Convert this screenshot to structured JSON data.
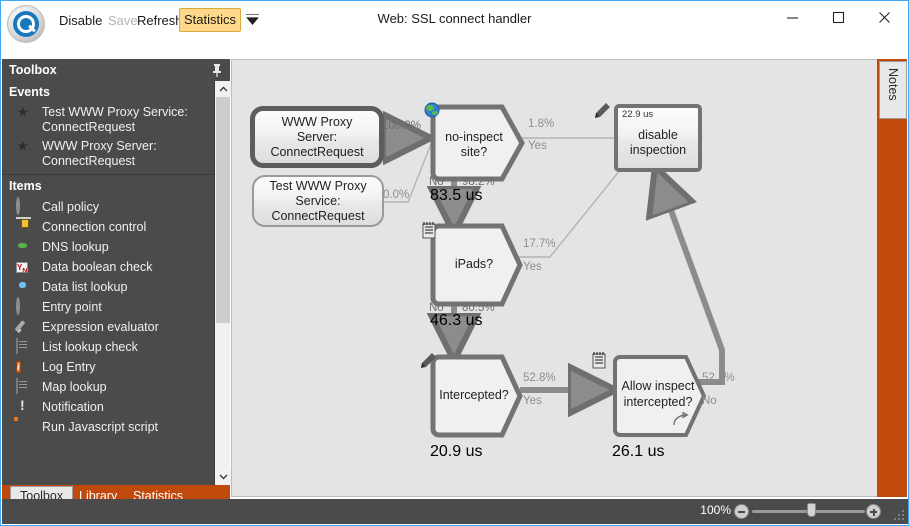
{
  "window": {
    "title": "Web: SSL connect handler",
    "logo_icon": "app-logo-icon",
    "minimize_icon": "minimize-icon",
    "maximize_icon": "maximize-icon",
    "close_icon": "close-icon"
  },
  "toolbar": {
    "disable_label": "Disable",
    "save_label": "Save",
    "refresh_label": "Refresh",
    "statistics_label": "Statistics",
    "overflow_icon": "chevron-down-icon"
  },
  "toolbox": {
    "title": "Toolbox",
    "pin_icon": "pin-icon",
    "groups": [
      {
        "title": "Events",
        "items": [
          {
            "label": "Test WWW Proxy Service: ConnectRequest",
            "icon": "star-icon"
          },
          {
            "label": "WWW Proxy Server: ConnectRequest",
            "icon": "star-icon"
          }
        ]
      },
      {
        "title": "Items",
        "items": [
          {
            "label": "Call policy",
            "icon": "call-policy-icon"
          },
          {
            "label": "Connection control",
            "icon": "connection-control-icon"
          },
          {
            "label": "DNS lookup",
            "icon": "dns-lookup-icon"
          },
          {
            "label": "Data boolean check",
            "icon": "data-boolean-check-icon"
          },
          {
            "label": "Data list lookup",
            "icon": "data-list-lookup-icon"
          },
          {
            "label": "Entry point",
            "icon": "entry-point-icon"
          },
          {
            "label": "Expression evaluator",
            "icon": "expression-evaluator-icon"
          },
          {
            "label": "List lookup check",
            "icon": "list-lookup-check-icon"
          },
          {
            "label": "Log Entry",
            "icon": "log-entry-icon"
          },
          {
            "label": "Map lookup",
            "icon": "map-lookup-icon"
          },
          {
            "label": "Notification",
            "icon": "notification-icon"
          },
          {
            "label": "Run Javascript script",
            "icon": "run-javascript-script-icon"
          }
        ]
      }
    ],
    "scroll_up_icon": "chevron-up-icon",
    "scroll_down_icon": "chevron-down-icon",
    "tabs": [
      {
        "label": "Toolbox",
        "active": true
      },
      {
        "label": "Library",
        "active": false
      },
      {
        "label": "Statistics",
        "active": false
      }
    ]
  },
  "notes_panel": {
    "label": "Notes"
  },
  "statusbar": {
    "zoom_label": "100%",
    "zoom_out_icon": "zoom-out-icon",
    "zoom_in_icon": "zoom-in-icon",
    "resize_grip_icon": "resize-grip-icon"
  },
  "diagram": {
    "background_color": "#e4e4e4",
    "nodes": [
      {
        "id": "start",
        "label": "WWW Proxy Server:\nConnectRequest",
        "line1": "WWW Proxy Server:",
        "line2": "ConnectRequest",
        "time": "",
        "shape": "rounded-bold",
        "icon": ""
      },
      {
        "id": "testsvc",
        "label": "Test WWW Proxy Service:\nConnectRequest",
        "line1": "Test WWW Proxy",
        "line2": "Service:",
        "line3": "ConnectRequest",
        "time": "",
        "shape": "rounded-thin",
        "icon": ""
      },
      {
        "id": "noinspect",
        "line1": "no-inspect",
        "line2": "site?",
        "time": "83.5 us",
        "shape": "decision",
        "icon": "globe-icon"
      },
      {
        "id": "disable",
        "line1": "disable",
        "line2": "inspection",
        "time": "22.9 us",
        "shape": "square",
        "icon": "pencil-icon"
      },
      {
        "id": "ipads",
        "line1": "iPads?",
        "line2": "",
        "time": "46.3 us",
        "shape": "decision",
        "icon": "list-icon"
      },
      {
        "id": "intercepted",
        "line1": "Intercepted?",
        "line2": "",
        "time": "20.9 us",
        "shape": "decision",
        "icon": "pencil-icon"
      },
      {
        "id": "allow",
        "line1": "Allow inspect",
        "line2": "intercepted?",
        "time": "26.1 us",
        "shape": "decision",
        "icon": "list-icon"
      }
    ],
    "edges": [
      {
        "from": "start",
        "to": "noinspect",
        "percent": "100.0%",
        "branch": ""
      },
      {
        "from": "testsvc",
        "to": "noinspect",
        "percent": "0.0%",
        "branch": ""
      },
      {
        "from": "noinspect",
        "to": "disable",
        "percent": "1.8%",
        "branch": "Yes"
      },
      {
        "from": "noinspect",
        "to": "ipads",
        "percent": "98.2%",
        "branch": "No"
      },
      {
        "from": "ipads",
        "to": "disable",
        "percent": "17.7%",
        "branch": "Yes"
      },
      {
        "from": "ipads",
        "to": "intercepted",
        "percent": "80.5%",
        "branch": "No"
      },
      {
        "from": "intercepted",
        "to": "allow",
        "percent": "52.8%",
        "branch": "Yes"
      },
      {
        "from": "allow",
        "to": "disable",
        "percent": "52.1%",
        "branch": "No"
      }
    ]
  }
}
